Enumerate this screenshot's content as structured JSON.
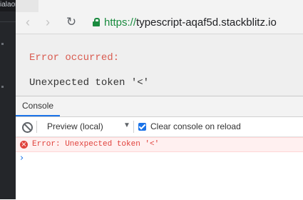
{
  "editor": {
    "tab_text": "ialaoralf."
  },
  "browser": {
    "nav": {
      "back_icon": "‹",
      "forward_icon": "›",
      "reload_icon": "↻"
    },
    "url": {
      "scheme": "https://",
      "host": "typescript-aqaf5d.stackblitz.io"
    }
  },
  "page": {
    "error_heading": "Error occurred:",
    "error_message": "Unexpected token '<'"
  },
  "devtools": {
    "tabs": [
      "Console"
    ],
    "toolbar": {
      "context_label": "Preview (local)",
      "context_arrow": "▼",
      "clear_on_reload_label": "Clear console on reload",
      "clear_on_reload_checked": true
    },
    "messages": [
      {
        "level": "error",
        "icon": "×",
        "text": "Error: Unexpected token '<'"
      }
    ],
    "prompt": "›"
  },
  "colors": {
    "error_red": "#e0423c",
    "secure_green": "#1a8b3f",
    "accent_blue": "#1a73e8"
  }
}
